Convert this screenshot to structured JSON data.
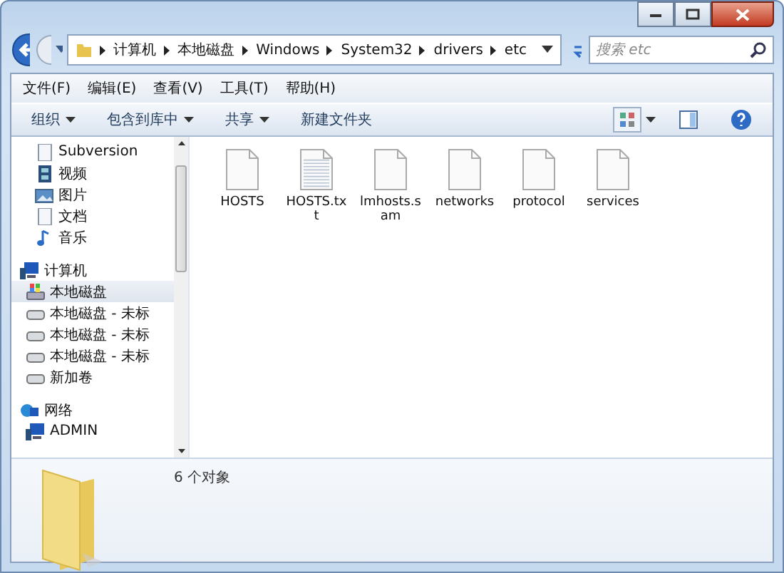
{
  "address": {
    "segments": [
      "计算机",
      "本地磁盘",
      "Windows",
      "System32",
      "drivers",
      "etc"
    ]
  },
  "search": {
    "placeholder": "搜索 etc"
  },
  "menu": [
    "文件(F)",
    "编辑(E)",
    "查看(V)",
    "工具(T)",
    "帮助(H)"
  ],
  "toolbar": [
    {
      "label": "组织",
      "dropdown": true
    },
    {
      "label": "包含到库中",
      "dropdown": true
    },
    {
      "label": "共享",
      "dropdown": true
    },
    {
      "label": "新建文件夹",
      "dropdown": false
    }
  ],
  "sidebar": {
    "items": [
      {
        "label": "Subversion",
        "kind": "svn",
        "selected": false
      },
      {
        "label": "视频",
        "kind": "video",
        "selected": false
      },
      {
        "label": "图片",
        "kind": "picture",
        "selected": false
      },
      {
        "label": "文档",
        "kind": "document",
        "selected": false
      },
      {
        "label": "音乐",
        "kind": "music",
        "selected": false
      },
      {
        "label": "计算机",
        "kind": "computer",
        "selected": false,
        "children": [
          {
            "label": "本地磁盘",
            "kind": "system-drive",
            "selected": true
          },
          {
            "label": "本地磁盘 - 未标",
            "kind": "drive",
            "selected": false
          },
          {
            "label": "本地磁盘 - 未标",
            "kind": "drive",
            "selected": false
          },
          {
            "label": "本地磁盘 - 未标",
            "kind": "drive",
            "selected": false
          },
          {
            "label": "新加卷",
            "kind": "drive",
            "selected": false
          }
        ]
      },
      {
        "label": "网络",
        "kind": "network",
        "selected": false,
        "children": [
          {
            "label": "ADMIN",
            "kind": "pc",
            "selected": false
          }
        ]
      }
    ]
  },
  "files": [
    {
      "name": "HOSTS",
      "kind": "file"
    },
    {
      "name": "HOSTS.txt",
      "kind": "text"
    },
    {
      "name": "lmhosts.sam",
      "kind": "file"
    },
    {
      "name": "networks",
      "kind": "file"
    },
    {
      "name": "protocol",
      "kind": "file"
    },
    {
      "name": "services",
      "kind": "file"
    }
  ],
  "details": {
    "count": "6 个对象"
  }
}
